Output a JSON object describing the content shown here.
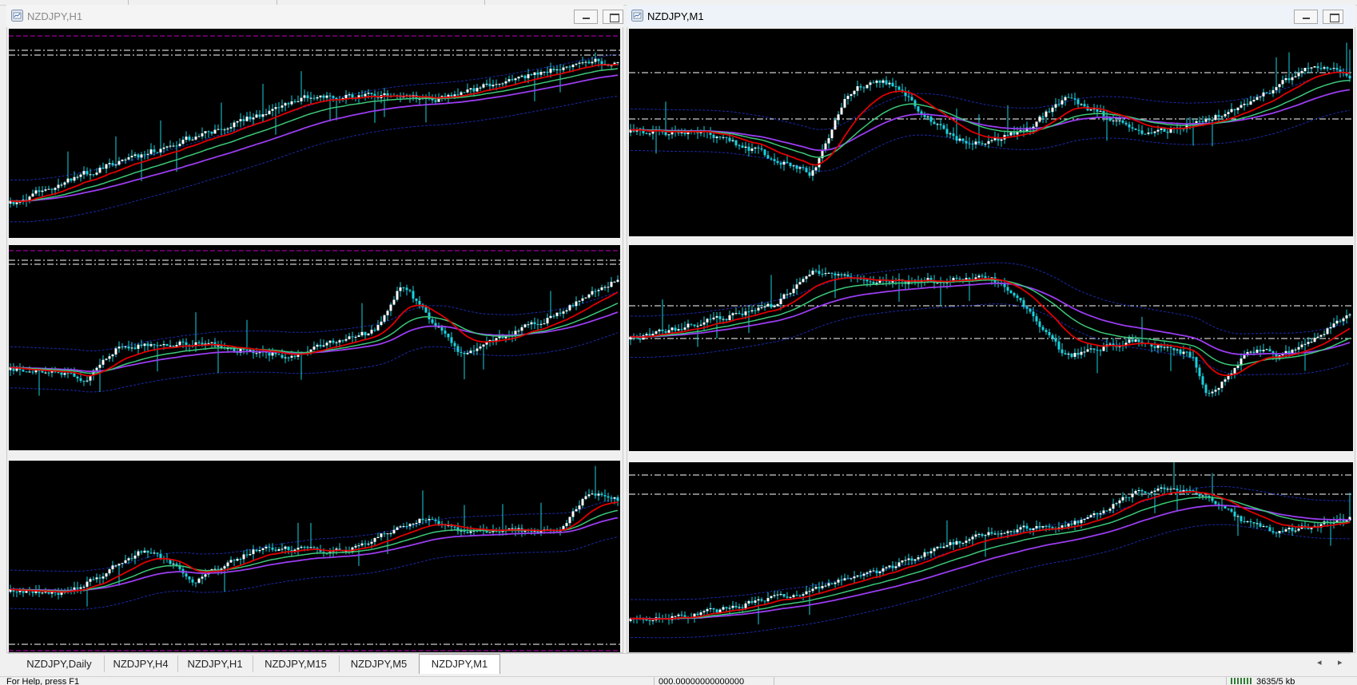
{
  "windows": [
    {
      "id": "w1",
      "title": "NZDJPY,H1",
      "active": false
    },
    {
      "id": "w2",
      "title": "NZDJPY,M1",
      "active": true
    }
  ],
  "tabs": [
    "NZDJPY,Daily",
    "NZDJPY,H4",
    "NZDJPY,H1",
    "NZDJPY,M15",
    "NZDJPY,M5",
    "NZDJPY,M1"
  ],
  "active_tab": "NZDJPY,M1",
  "scroll": {
    "left": "◂",
    "right": "▸"
  },
  "status": {
    "left": "For Help, press F1",
    "middle": "000.00000000000000",
    "right": "3635/5 kb"
  },
  "colors": {
    "chart_bg": "#000000",
    "candle": "#19d2e0",
    "candle_up": "#ffffff",
    "ma_fast": "#e00000",
    "ma_mid": "#3cc878",
    "ma_slow": "#9a3cf0",
    "bollinger": "#1a2aa8",
    "level_line": "#ffffff",
    "high_line": "#c000c0"
  },
  "icons": {
    "window": "chart-window-icon",
    "minimize": "minimize-icon",
    "maximize": "maximize-icon"
  }
}
